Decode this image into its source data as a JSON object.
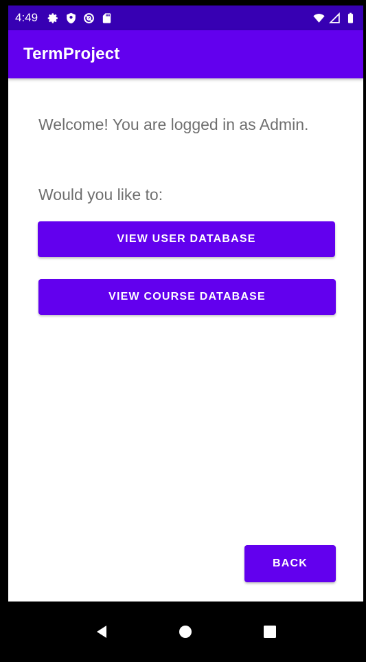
{
  "status_bar": {
    "time": "4:49",
    "left_icons": [
      "gear-icon",
      "shield-icon",
      "at-sign-icon",
      "sd-card-icon"
    ],
    "right_icons": [
      "wifi-icon",
      "signal-icon",
      "battery-icon"
    ]
  },
  "app_bar": {
    "title": "TermProject"
  },
  "main": {
    "welcome_text": "Welcome! You are logged in as Admin.",
    "prompt_text": "Would you like to:",
    "view_user_db_label": "VIEW USER DATABASE",
    "view_course_db_label": "VIEW COURSE DATABASE",
    "back_label": "BACK"
  },
  "nav_bar": {
    "icons": [
      "back-triangle-icon",
      "home-circle-icon",
      "recents-square-icon"
    ]
  },
  "colors": {
    "status_bar": "#3700b3",
    "primary": "#6200ee",
    "text_secondary": "#6f6f6f"
  }
}
